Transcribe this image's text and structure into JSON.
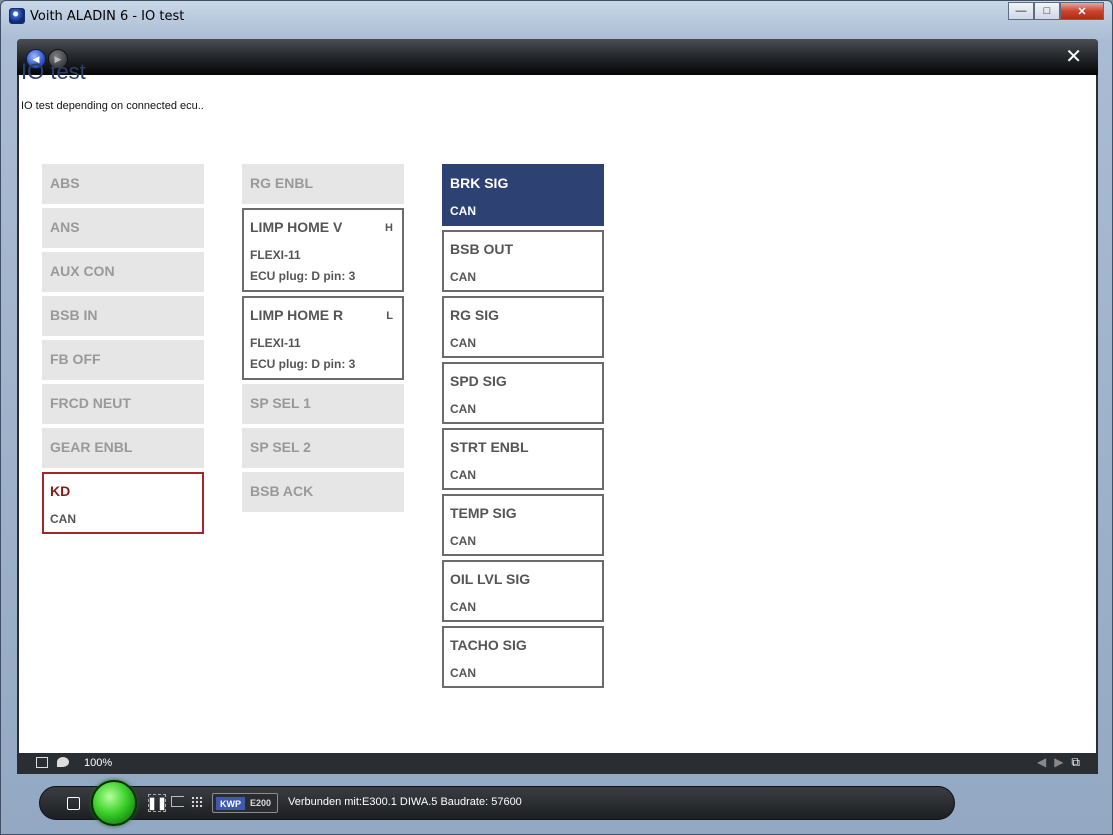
{
  "window": {
    "title": "Voith ALADIN 6 - IO test",
    "controls": {
      "minimize": "—",
      "maximize": "□",
      "close": "✕"
    }
  },
  "nav": {
    "back_icon": "◀",
    "forward_icon": "▶",
    "close_icon": "✕"
  },
  "page": {
    "title": "IO test",
    "subtitle": "IO test depending on connected ecu.."
  },
  "columns": [
    {
      "tiles": [
        {
          "label": "ABS",
          "state": "disabled"
        },
        {
          "label": "ANS",
          "state": "disabled"
        },
        {
          "label": "AUX CON",
          "state": "disabled"
        },
        {
          "label": "BSB IN",
          "state": "disabled"
        },
        {
          "label": "FB OFF",
          "state": "disabled"
        },
        {
          "label": "FRCD NEUT",
          "state": "disabled"
        },
        {
          "label": "GEAR ENBL",
          "state": "disabled"
        },
        {
          "label": "KD",
          "sub": "CAN",
          "state": "error"
        }
      ]
    },
    {
      "tiles": [
        {
          "label": "RG ENBL",
          "state": "disabled"
        },
        {
          "label": "LIMP HOME V",
          "suffix": "H",
          "sub": "FLEXI-11",
          "sub2": "ECU plug: D pin: 3",
          "state": "active"
        },
        {
          "label": "LIMP HOME R",
          "suffix": "L",
          "sub": "FLEXI-11",
          "sub2": "ECU plug: D pin: 3",
          "state": "active"
        },
        {
          "label": "SP SEL 1",
          "state": "disabled"
        },
        {
          "label": "SP SEL 2",
          "state": "disabled"
        },
        {
          "label": "BSB ACK",
          "state": "disabled"
        }
      ]
    },
    {
      "tiles": [
        {
          "label": "BRK SIG",
          "sub": "CAN",
          "state": "selected"
        },
        {
          "label": "BSB OUT",
          "sub": "CAN",
          "state": "active"
        },
        {
          "label": "RG SIG",
          "sub": "CAN",
          "state": "active"
        },
        {
          "label": "SPD SIG",
          "sub": "CAN",
          "state": "active"
        },
        {
          "label": "STRT ENBL",
          "sub": "CAN",
          "state": "active"
        },
        {
          "label": "TEMP SIG",
          "sub": "CAN",
          "state": "active"
        },
        {
          "label": "OIL LVL SIG",
          "sub": "CAN",
          "state": "active"
        },
        {
          "label": "TACHO SIG",
          "sub": "CAN",
          "state": "active"
        }
      ]
    }
  ],
  "status": {
    "zoom": "100%",
    "prev_icon": "◀",
    "next_icon": "▶",
    "expand_icon": "⧉"
  },
  "toolbar": {
    "protocol": "KWP",
    "ecu": "E200",
    "connection": "Verbunden mit:E300.1  DIWA.5 Baudrate: 57600",
    "pause_icon": "❚❚"
  },
  "colors": {
    "selected": "#2d4172",
    "error": "#a3262a",
    "title": "#2c3e66",
    "led": "#3bd12a"
  }
}
